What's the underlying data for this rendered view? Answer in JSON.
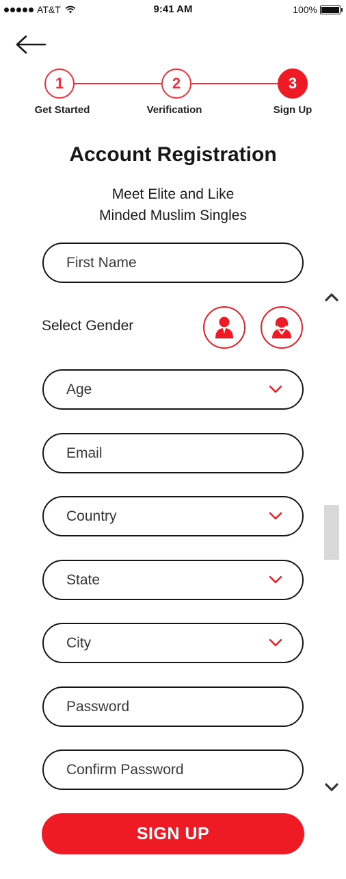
{
  "status_bar": {
    "carrier": "AT&T",
    "time": "9:41 AM",
    "battery": "100%",
    "battery_level": 1.0,
    "icons": [
      "signal-dots-icon",
      "wifi-icon",
      "battery-icon"
    ]
  },
  "nav": {
    "back_icon": "back-arrow-icon"
  },
  "stepper": {
    "steps": [
      {
        "number": "1",
        "label": "Get Started"
      },
      {
        "number": "2",
        "label": "Verification"
      },
      {
        "number": "3",
        "label": "Sign Up"
      }
    ],
    "active_step": 3
  },
  "header": {
    "title": "Account Registration",
    "subtitle_line1": "Meet Elite and Like",
    "subtitle_line2": "Minded Muslim Singles"
  },
  "form": {
    "first_name": {
      "placeholder": "First Name",
      "value": ""
    },
    "gender": {
      "label": "Select Gender",
      "options": [
        "male-icon",
        "female-icon"
      ]
    },
    "age": {
      "placeholder": "Age"
    },
    "email": {
      "placeholder": "Email",
      "value": ""
    },
    "country": {
      "placeholder": "Country"
    },
    "state": {
      "placeholder": "State"
    },
    "city": {
      "placeholder": "City"
    },
    "password": {
      "placeholder": "Password",
      "value": ""
    },
    "confirm_password": {
      "placeholder": "Confirm Password",
      "value": ""
    },
    "submit_label": "SIGN UP"
  },
  "colors": {
    "accent": "#ee1b24",
    "step_line": "#f2303a",
    "text_dark": "#161616",
    "scroll_thumb": "#d8d8d8"
  }
}
